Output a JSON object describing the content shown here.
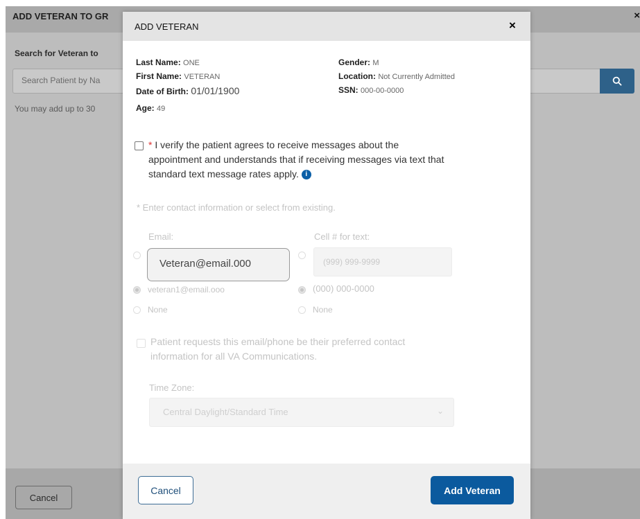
{
  "background": {
    "title": "ADD VETERAN TO GR",
    "close": "×",
    "search_label": "Search for Veteran to",
    "search_placeholder": "Search Patient by Na",
    "note": "You may add up to 30",
    "cancel_label": "Cancel"
  },
  "modal": {
    "title": "ADD VETERAN",
    "close": "×",
    "patient": {
      "last_name_label": "Last Name:",
      "last_name": "ONE",
      "first_name_label": "First Name:",
      "first_name": "VETERAN",
      "dob_label": "Date of Birth:",
      "dob": "01/01/1900",
      "age_label": "Age:",
      "age": "49",
      "gender_label": "Gender:",
      "gender": "M",
      "location_label": "Location:",
      "location": "Not Currently Admitted",
      "ssn_label": "SSN:",
      "ssn": "000-00-0000"
    },
    "verify_required": "*",
    "verify_text": "I verify the patient agrees to receive messages about the appointment and understands that if receiving messages via text that standard text message rates apply.",
    "contact_prompt": "* Enter contact information or select from existing.",
    "email_label": "Email:",
    "email_value": "Veteran@email.000",
    "email_options": [
      "veteran1@email.ooo",
      "None"
    ],
    "phone_label": "Cell # for text:",
    "phone_placeholder": "(999) 999-9999",
    "phone_options": [
      "(000) 000-0000",
      "None"
    ],
    "preferred_text": "Patient requests this email/phone be their preferred contact information for all VA Communications.",
    "timezone_label": "Time Zone:",
    "timezone_value": "Central Daylight/Standard Time",
    "cancel_label": "Cancel",
    "add_label": "Add Veteran"
  },
  "colors": {
    "primary": "#0b5a9e",
    "overlay": "#bdbdbd",
    "required": "#d33333"
  }
}
